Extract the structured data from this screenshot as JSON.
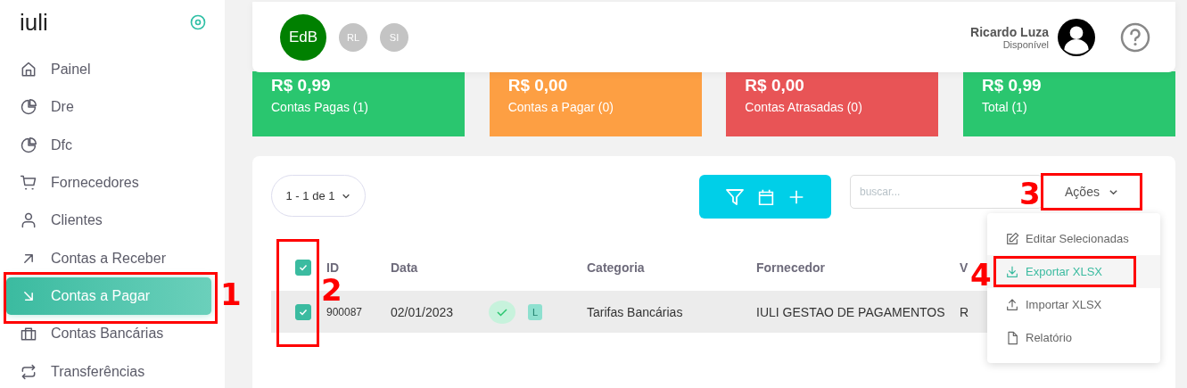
{
  "sidebar": {
    "logo": "iuli",
    "items": [
      {
        "label": "Painel",
        "selected": false
      },
      {
        "label": "Dre",
        "selected": false
      },
      {
        "label": "Dfc",
        "selected": false
      },
      {
        "label": "Fornecedores",
        "selected": false
      },
      {
        "label": "Clientes",
        "selected": false
      },
      {
        "label": "Contas a Receber",
        "selected": false
      },
      {
        "label": "Contas a Pagar",
        "selected": true,
        "annotation": "1"
      },
      {
        "label": "Contas Bancárias",
        "selected": false
      },
      {
        "label": "Transferências",
        "selected": false
      }
    ]
  },
  "header": {
    "companies": [
      {
        "initials": "EdB",
        "selected": true
      },
      {
        "initials": "RL",
        "selected": false
      },
      {
        "initials": "SI",
        "selected": false
      }
    ],
    "user": {
      "name": "Ricardo Luza",
      "status": "Disponível"
    }
  },
  "summary_cards": [
    {
      "amount": "R$ 0,99",
      "label": "Contas Pagas (1)",
      "color": "#2ac66f"
    },
    {
      "amount": "R$ 0,00",
      "label": "Contas a Pagar (0)",
      "color": "#fd9f43"
    },
    {
      "amount": "R$ 0,00",
      "label": "Contas Atrasadas (0)",
      "color": "#e85456"
    },
    {
      "amount": "R$ 0,99",
      "label": "Total (1)",
      "color": "#2ac66f"
    }
  ],
  "table": {
    "pagination": "1 - 1 de 1",
    "search": {
      "placeholder": "buscar..."
    },
    "actions_button": {
      "label": "Ações",
      "expanded": true,
      "annotation": "3"
    },
    "actions_menu": [
      {
        "label": "Editar Selecionadas",
        "kind": "edit",
        "selected": false
      },
      {
        "label": "Exportar XLSX",
        "kind": "download",
        "selected": true,
        "annotation": "4"
      },
      {
        "label": "Importar XLSX",
        "kind": "upload",
        "selected": false
      },
      {
        "label": "Relatório",
        "kind": "file",
        "selected": false
      }
    ],
    "select_all": {
      "checked": true
    },
    "checkbox_annotation": "2",
    "columns": [
      "ID",
      "Data",
      "",
      "Categoria",
      "Fornecedor",
      "V"
    ],
    "rows": [
      {
        "checked": true,
        "id": "900087",
        "date": "02/01/2023",
        "paid": true,
        "tag": "L",
        "category": "Tarifas Bancárias",
        "supplier": "IULI GESTAO DE PAGAMENTOS",
        "column_6": "R"
      }
    ]
  }
}
